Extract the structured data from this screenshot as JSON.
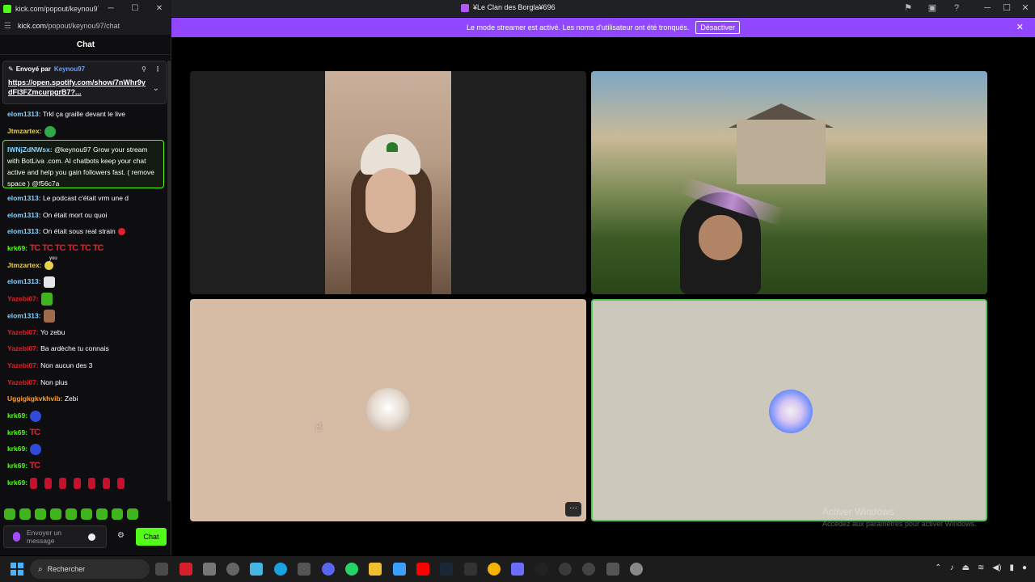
{
  "popout": {
    "title": "kick.com/popout/keynou97...",
    "url_domain": "kick.com",
    "url_path": "/popout/keynou97/chat",
    "chat_header": "Chat"
  },
  "pinned": {
    "sent_by": "Envoyé par",
    "user": "Keynou97",
    "link": "https://open.spotify.com/show/7nWhr9ydFI3FZmcurpgrB7?..."
  },
  "messages": [
    {
      "user": "elom1313:",
      "color": "#8ad3ff",
      "text": "Trkl ça graille devant le live"
    },
    {
      "user": "Jtmzartex:",
      "color": "#e8d24a",
      "text": ""
    },
    {
      "user": "elom1313:",
      "color": "#8ad3ff",
      "text": "Le podcast c'était vrm une d"
    },
    {
      "user": "elom1313:",
      "color": "#8ad3ff",
      "text": "On était mort ou quoi"
    },
    {
      "user": "elom1313:",
      "color": "#8ad3ff",
      "text": "On était sous real strain"
    },
    {
      "user": "krk69:",
      "color": "#53fc18",
      "text": ""
    },
    {
      "user": "Jtmzartex:",
      "color": "#e8d24a",
      "text": ""
    },
    {
      "user": "elom1313:",
      "color": "#8ad3ff",
      "text": ""
    },
    {
      "user": "Yazebi07:",
      "color": "#e0222c",
      "text": ""
    },
    {
      "user": "elom1313:",
      "color": "#8ad3ff",
      "text": ""
    },
    {
      "user": "Yazebi07:",
      "color": "#e0222c",
      "text": "Yo zebu"
    },
    {
      "user": "Yazebi07:",
      "color": "#e0222c",
      "text": "Ba ardèche tu connais"
    },
    {
      "user": "Yazebi07:",
      "color": "#e0222c",
      "text": "Non aucun des 3"
    },
    {
      "user": "Yazebi07:",
      "color": "#e0222c",
      "text": "Non plus"
    },
    {
      "user": "Uggigkgkvkhvib:",
      "color": "#ff9e2a",
      "text": "Zebi"
    },
    {
      "user": "krk69:",
      "color": "#53fc18",
      "text": ""
    },
    {
      "user": "krk69:",
      "color": "#53fc18",
      "text": ""
    },
    {
      "user": "krk69:",
      "color": "#53fc18",
      "text": ""
    },
    {
      "user": "krk69:",
      "color": "#53fc18",
      "text": ""
    },
    {
      "user": "krk69:",
      "color": "#53fc18",
      "text": ""
    }
  ],
  "emote_text": "TC",
  "emote_caption": "you",
  "spam": {
    "user": "IWNjZdNWsx:",
    "text": "@keynou97 Grow your stream with BotLiva .com. AI chatbots keep your chat active and help you gain followers fast. ( remove space ) @f56c7a"
  },
  "chat_input": {
    "placeholder": "Envoyer un message",
    "send_label": "Chat"
  },
  "browser": {
    "title": "¥Le Clan des Borgla¥696",
    "banner_text": "Le mode streamer est activé. Les noms d'utilisateur ont été tronqués.",
    "banner_button": "Désactiver"
  },
  "watermark": {
    "line1": "Activer Windows",
    "line2": "Accédez aux paramètres pour activer Windows."
  },
  "taskbar": {
    "search_placeholder": "Rechercher"
  },
  "colors": {
    "kick_green": "#53fc18",
    "banner_purple": "#9146ff",
    "active_speaker_border": "#4ec95a"
  }
}
